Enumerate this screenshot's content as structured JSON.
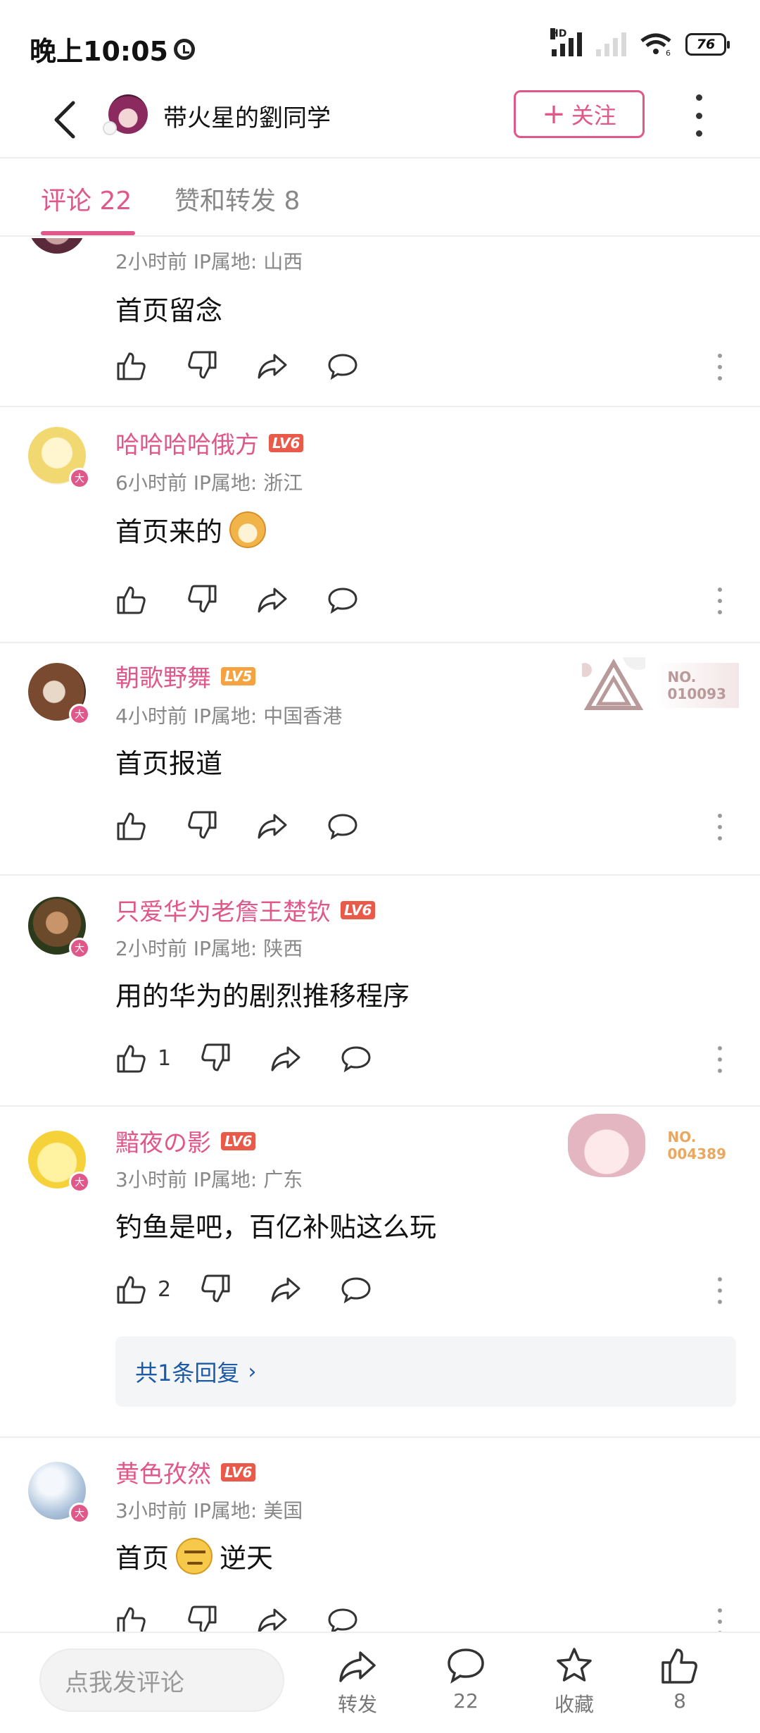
{
  "status_bar": {
    "time": "晚上10:05",
    "network_label": "HD",
    "wifi_sub": "6",
    "battery": "76"
  },
  "header": {
    "title": "带火星的劉同学",
    "follow_label": "关注"
  },
  "tabs": [
    {
      "label": "评论 22"
    },
    {
      "label": "赞和转发 8"
    }
  ],
  "comments": [
    {
      "meta": "2小时前 IP属地: 山西",
      "text": "首页留念"
    },
    {
      "name": "哈哈哈哈俄方",
      "level": "LV6",
      "meta": "6小时前 IP属地: 浙江",
      "text": "首页来的",
      "emoji": "doge"
    },
    {
      "name": "朝歌野舞",
      "level": "LV5",
      "meta": "4小时前 IP属地: 中国香港",
      "text": "首页报道",
      "fan_no_label": "NO.",
      "fan_no": "010093"
    },
    {
      "name": "只爱华为老詹王楚钦",
      "level": "LV6",
      "meta": "2小时前 IP属地: 陕西",
      "text": "用的华为的剧烈推移程序",
      "likes": "1"
    },
    {
      "name": "黯夜の影",
      "level": "LV6",
      "meta": "3小时前 IP属地: 广东",
      "text": "钓鱼是吧，百亿补贴这么玩",
      "likes": "2",
      "fan_no_label": "NO.",
      "fan_no": "004389",
      "replies_label": "共1条回复"
    },
    {
      "name": "黄色孜然",
      "level": "LV6",
      "meta": "3小时前 IP属地: 美国",
      "text_before": "首页",
      "text_after": "逆天",
      "emoji": "grumpy"
    }
  ],
  "avatar_badge": "大",
  "bottom_bar": {
    "input_placeholder": "点我发评论",
    "repost_label": "转发",
    "comment_count": "22",
    "favorite_label": "收藏",
    "like_count": "8"
  },
  "colors": {
    "accent": "#e0578a",
    "link": "#1c5aa8",
    "lv6": "#ea5a4a",
    "lv5": "#f4a340"
  }
}
